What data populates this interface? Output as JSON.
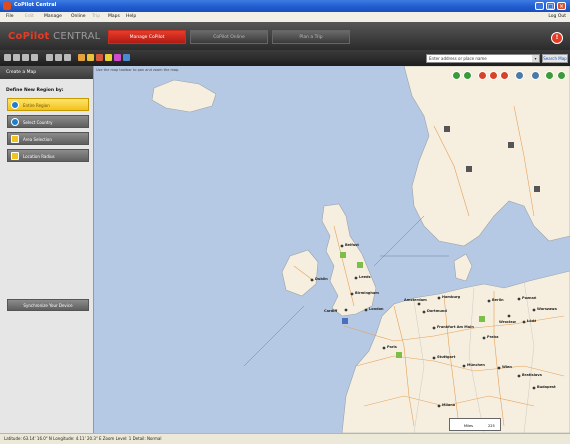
{
  "window": {
    "title": "CoPilot Central",
    "controls": {
      "minimize": "_",
      "maximize": "□",
      "close": "×"
    }
  },
  "menu": {
    "items": [
      {
        "label": "File",
        "enabled": true
      },
      {
        "label": "Edit",
        "enabled": false
      },
      {
        "label": "Manage",
        "enabled": true
      },
      {
        "label": "Online",
        "enabled": true
      },
      {
        "label": "Trip",
        "enabled": false
      },
      {
        "label": "Maps",
        "enabled": true
      },
      {
        "label": "Help",
        "enabled": true
      }
    ],
    "logout": "Log Out"
  },
  "header": {
    "logo_part1": "CoPilot",
    "logo_part2": "CENTRAL",
    "tabs": [
      {
        "label": "Manage CoPilot",
        "active": true
      },
      {
        "label": "CoPilot Online",
        "active": false
      },
      {
        "label": "Plan a Trip",
        "active": false
      }
    ],
    "sos_icon": "!"
  },
  "toolbar": {
    "search_placeholder": "Enter address or place name",
    "search_button": "Search Map"
  },
  "sidebar": {
    "title": "Create a Map",
    "subtitle": "Define New Region by:",
    "options": [
      {
        "label": "Entire Region",
        "selected": true,
        "icon": "globe-icon"
      },
      {
        "label": "Select Country",
        "selected": false,
        "icon": "globe-icon"
      },
      {
        "label": "Area Selection",
        "selected": false,
        "icon": "selection-icon"
      },
      {
        "label": "Location Radius",
        "selected": false,
        "icon": "radius-icon"
      }
    ],
    "sync_button": "Synchronize Your Device"
  },
  "map": {
    "hint": "Use the map toolbar to pan and zoom the map.",
    "city_labels": [
      "Belfast",
      "Dublin",
      "Leeds",
      "Birmingham",
      "Cardiff",
      "London",
      "Paris",
      "Amsterdam",
      "Hamburg",
      "Berlin",
      "Frankfurt Am Main",
      "Praha",
      "Stuttgart",
      "München",
      "Wien",
      "Bratislava",
      "Budapest",
      "Dortmund",
      "Poznań",
      "Warszawa",
      "Łódź",
      "Wrocław",
      "Milano"
    ],
    "scale": {
      "unit": "Miles",
      "value": "225"
    }
  },
  "status": {
    "text": "Latitude: 63.14' 16.0\" N  Longitude: 4.11' 20.3\" E  Zoom Level: 1  Detail: Normal"
  },
  "colors": {
    "accent_red": "#e23a23",
    "sea": "#b6c9e4",
    "land": "#f6efdf",
    "selected_option": "#f2c21c"
  }
}
